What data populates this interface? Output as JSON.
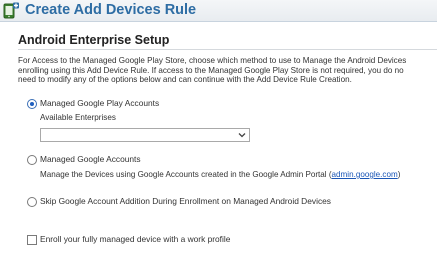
{
  "header": {
    "title": "Create Add Devices Rule"
  },
  "section": {
    "title": "Android Enterprise Setup",
    "description_lines": [
      "For Access to the Managed Google Play Store, choose which method to use to Manage the Android Devices",
      "enrolling using this Add Device Rule. If access to the Managed Google Play Store is not required, you do no",
      "need to modify any of the options below and can continue with the Add Device Rule Creation."
    ]
  },
  "options": {
    "managed_play": {
      "label": "Managed Google Play Accounts",
      "checked": true,
      "enterprises_label": "Available Enterprises",
      "enterprises_value": ""
    },
    "managed_google": {
      "label": "Managed Google Accounts",
      "checked": false,
      "note_prefix": "Manage the Devices using Google Accounts created in the Google Admin Portal (",
      "note_link": "admin.google.com",
      "note_suffix": ")"
    },
    "skip": {
      "label": "Skip Google Account Addition During Enrollment on Managed Android Devices",
      "checked": false
    }
  },
  "work_profile": {
    "label": "Enroll your fully managed device with a work profile",
    "checked": false
  },
  "colors": {
    "title_blue": "#2e6da4",
    "link_blue": "#1a56b6"
  }
}
